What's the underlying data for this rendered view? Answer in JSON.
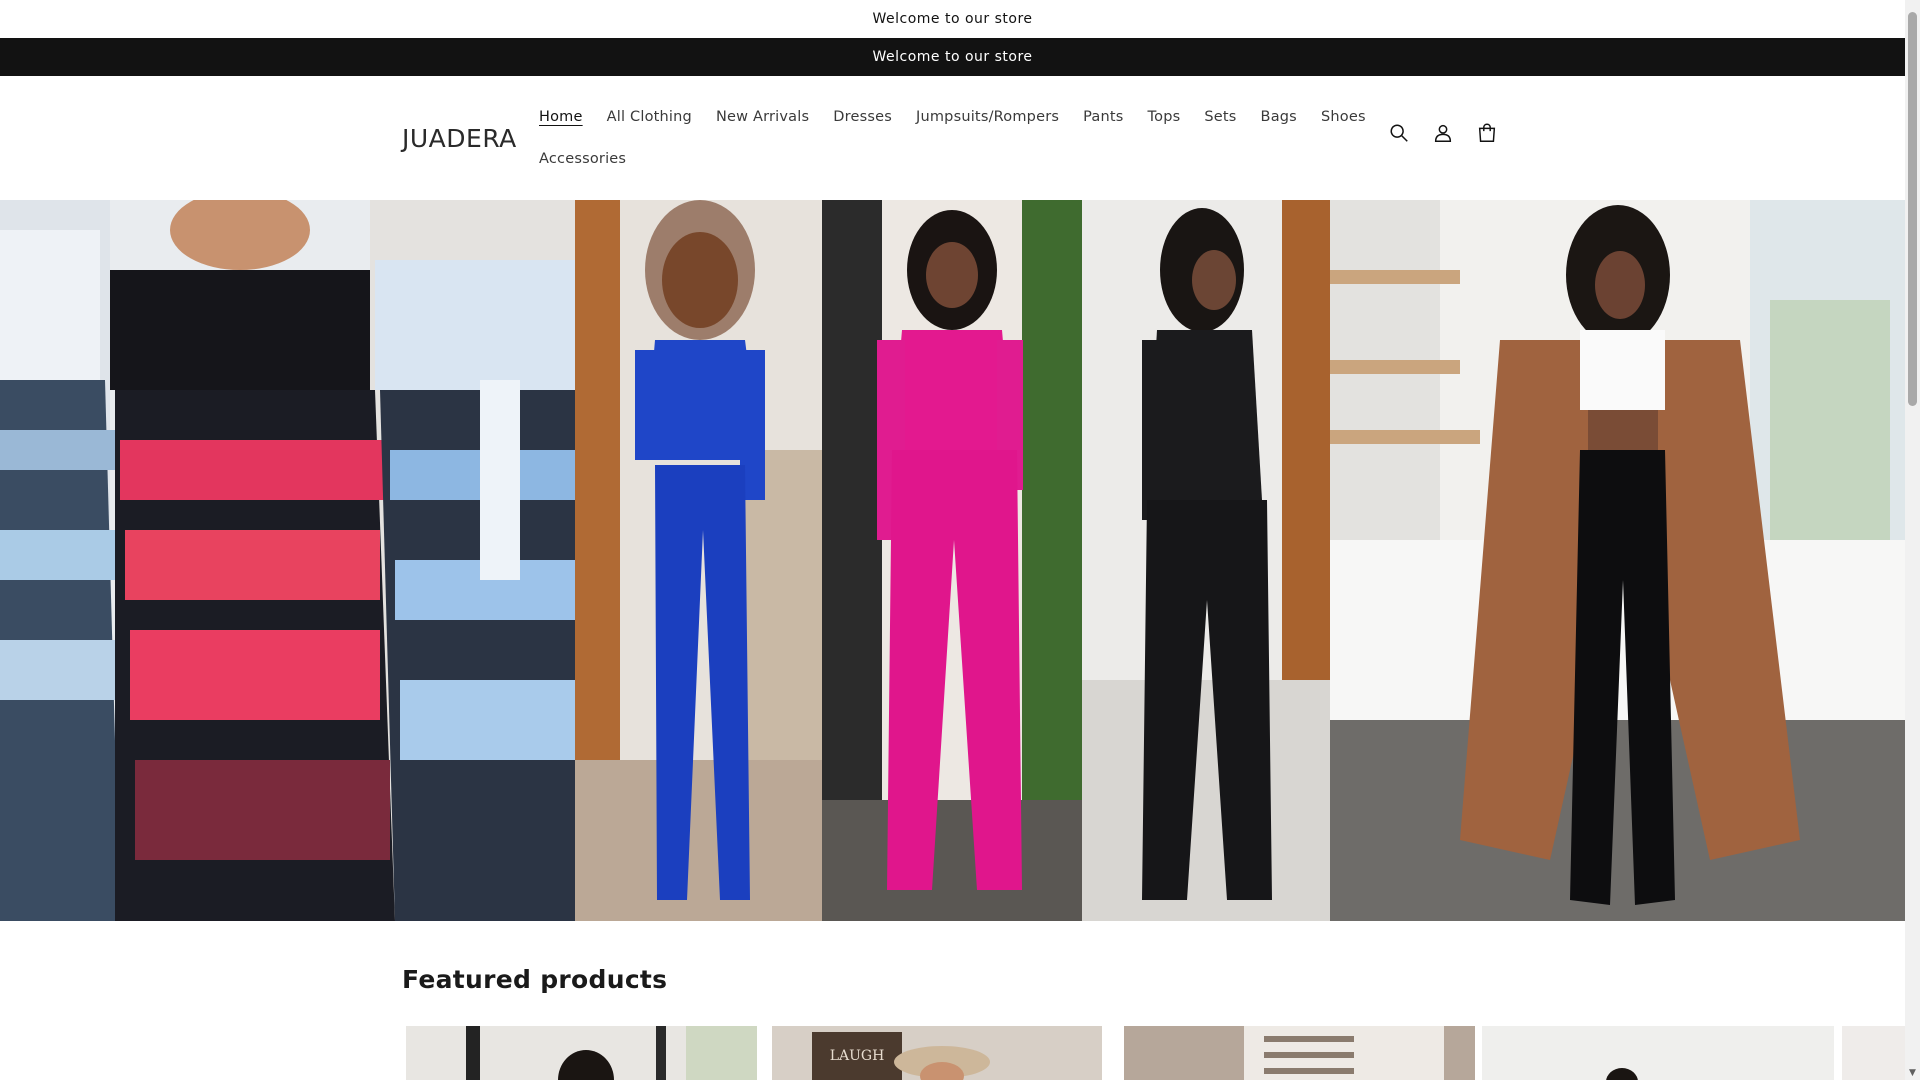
{
  "announcement": {
    "top_text": "Welcome to our store",
    "bar_text": "Welcome to our store"
  },
  "header": {
    "logo": "JUADERA",
    "nav": [
      {
        "label": "Home",
        "active": true
      },
      {
        "label": "All Clothing"
      },
      {
        "label": "New Arrivals"
      },
      {
        "label": "Dresses"
      },
      {
        "label": "Jumpsuits/Rompers"
      },
      {
        "label": "Pants"
      },
      {
        "label": "Tops"
      },
      {
        "label": "Sets"
      },
      {
        "label": "Bags"
      },
      {
        "label": "Shoes"
      },
      {
        "label": "Accessories"
      }
    ],
    "icons": [
      "search-icon",
      "account-icon",
      "cart-icon"
    ]
  },
  "hero": {
    "panels": [
      "tulle-skirt-outfits",
      "blue-fringe-set",
      "pink-fringe-set",
      "black-fringe-set",
      "cardigan-leggings-outfit"
    ]
  },
  "featured": {
    "title": "Featured products"
  },
  "colors": {
    "announcement_bar": "#121212",
    "text": "#121212"
  }
}
